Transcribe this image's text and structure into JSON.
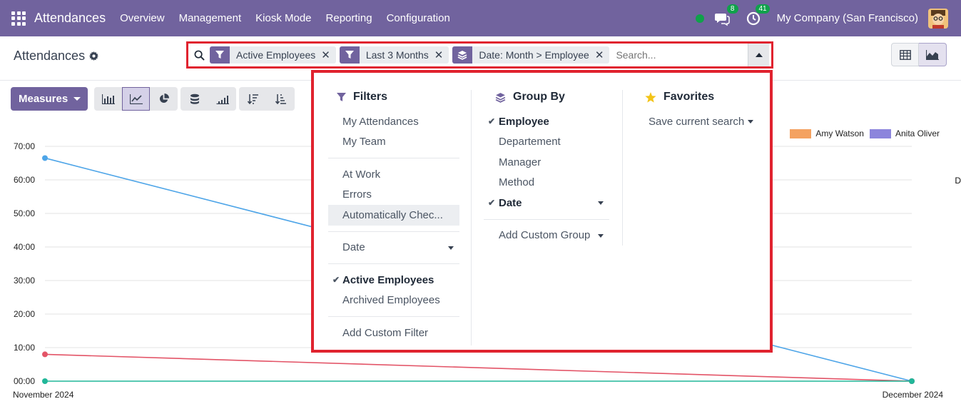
{
  "navbar": {
    "app_name": "Attendances",
    "menu": [
      "Overview",
      "Management",
      "Kiosk Mode",
      "Reporting",
      "Configuration"
    ],
    "messages_count": "8",
    "activities_count": "41",
    "company": "My Company (San Francisco)"
  },
  "control_panel": {
    "title": "Attendances",
    "facets": [
      {
        "icon": "filter-icon",
        "label": "Active Employees"
      },
      {
        "icon": "filter-icon",
        "label": "Last 3 Months"
      },
      {
        "icon": "layers-icon",
        "label": "Date: Month > Employee"
      }
    ],
    "search_placeholder": "Search...",
    "facet_remove": "✕"
  },
  "toolbar": {
    "measures_label": "Measures"
  },
  "chart_data": {
    "type": "line",
    "x": [
      "November 2024",
      "December 2024"
    ],
    "yticks": [
      "00:00",
      "10:00",
      "20:00",
      "30:00",
      "40:00",
      "50:00",
      "60:00",
      "70:00"
    ],
    "ylim": [
      0,
      70
    ],
    "series": [
      {
        "name": "",
        "color": "#4ea5e8",
        "values": [
          66.5,
          0
        ]
      },
      {
        "name": "",
        "color": "#e35467",
        "values": [
          8,
          0
        ]
      },
      {
        "name": "",
        "color": "#21b799",
        "values": [
          0,
          0
        ]
      }
    ],
    "legend": [
      {
        "name": "Amy Watson",
        "color": "#f4a261"
      },
      {
        "name": "Anita Oliver",
        "color": "#8c85dc"
      }
    ],
    "grid": true
  },
  "edge_text": "D",
  "dropdown": {
    "filters": {
      "heading": "Filters",
      "group1": [
        "My Attendances",
        "My Team"
      ],
      "group2": [
        "At Work",
        "Errors",
        "Automatically Chec..."
      ],
      "date_label": "Date",
      "active_employees": "Active Employees",
      "archived_employees": "Archived Employees",
      "add_custom_filter": "Add Custom Filter"
    },
    "groupby": {
      "heading": "Group By",
      "employee": "Employee",
      "department": "Departement",
      "manager": "Manager",
      "method": "Method",
      "date": "Date",
      "add_custom_group": "Add Custom Group"
    },
    "favorites": {
      "heading": "Favorites",
      "save_search": "Save current search"
    }
  }
}
